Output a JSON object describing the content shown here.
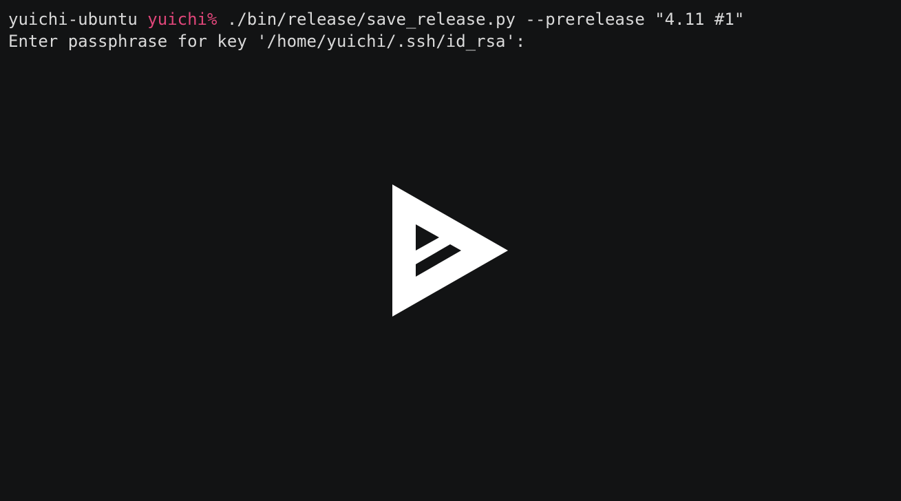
{
  "terminal": {
    "line1": {
      "host": "yuichi-ubuntu",
      "user_prompt": "yuichi%",
      "command": "./bin/release/save_release.py --prerelease \"4.11 #1\""
    },
    "line2": {
      "text": "Enter passphrase for key '/home/yuichi/.ssh/id_rsa':"
    }
  },
  "colors": {
    "background": "#121314",
    "text": "#d9d9d9",
    "prompt_user": "#e0467a",
    "play_icon": "#ffffff"
  },
  "overlay": {
    "icon": "asciinema-play-icon"
  }
}
